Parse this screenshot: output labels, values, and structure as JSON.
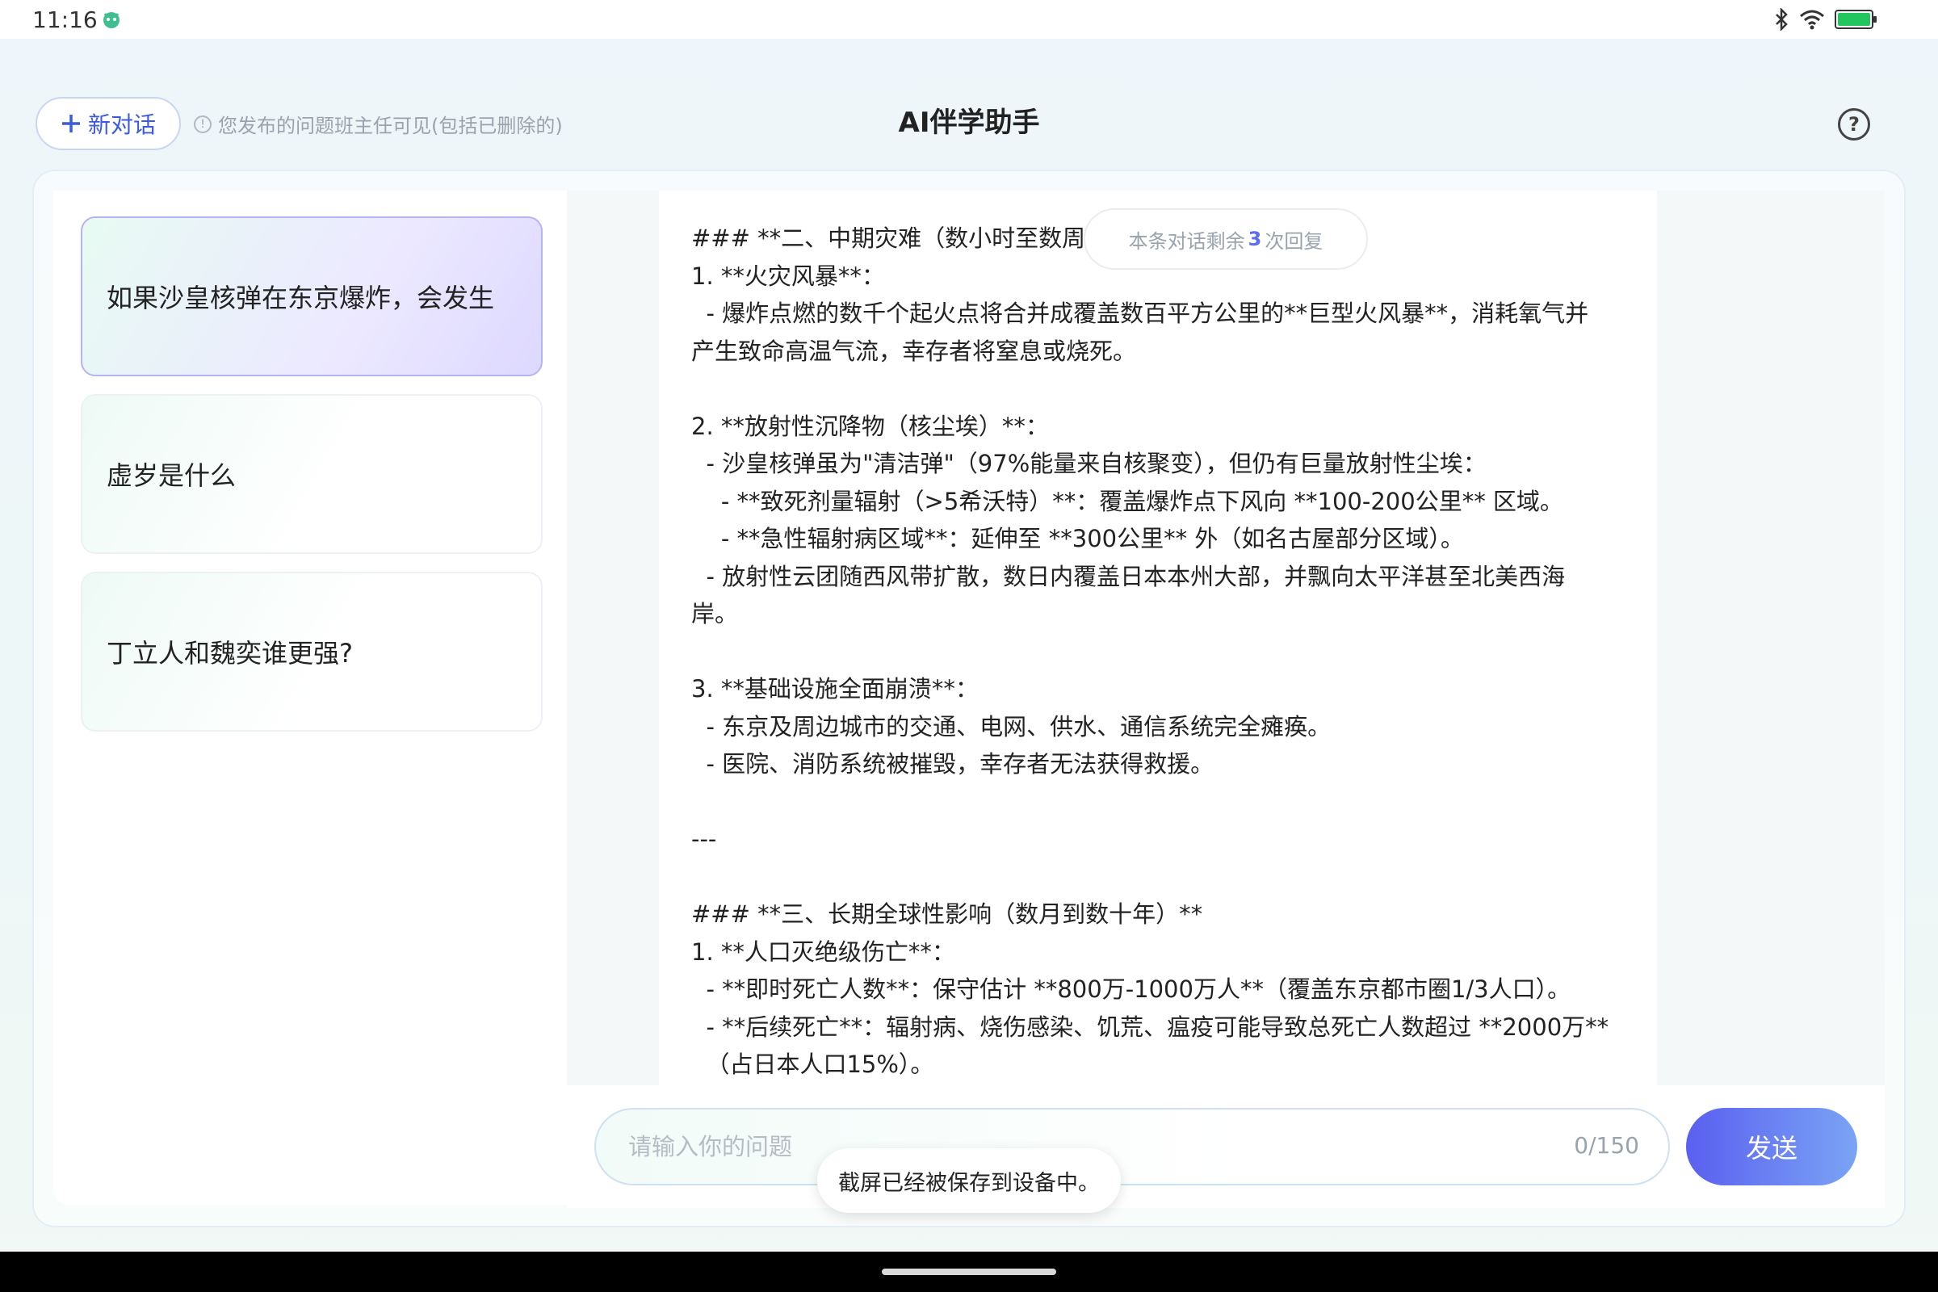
{
  "status_bar": {
    "time": "11:16",
    "battery_color": "#22c55e"
  },
  "header": {
    "new_chat_label": "新对话",
    "notice": "您发布的问题班主任可见(包括已删除的)",
    "title": "AI伴学助手"
  },
  "conversations": [
    {
      "title": "如果沙皇核弹在东京爆炸，会发生",
      "active": true
    },
    {
      "title": "虚岁是什么",
      "active": false
    },
    {
      "title": "丁立人和魏奕谁更强?",
      "active": false
    }
  ],
  "chat": {
    "remaining_prefix": "本条对话剩余",
    "remaining_count": "3",
    "remaining_suffix": "次回复",
    "lines": [
      "### **二、中期灾难（数小时至数周）",
      "1. **火灾风暴**：",
      "  - 爆炸点燃的数千个起火点将合并成覆盖数百平方公里的**巨型火风暴**，消耗氧气并",
      "产生致命高温气流，幸存者将窒息或烧死。",
      "",
      "2. **放射性沉降物（核尘埃）**：",
      "  - 沙皇核弹虽为\"清洁弹\"（97%能量来自核聚变），但仍有巨量放射性尘埃：",
      "    - **致死剂量辐射（>5希沃特）**：覆盖爆炸点下风向 **100-200公里** 区域。",
      "    - **急性辐射病区域**：延伸至 **300公里** 外（如名古屋部分区域）。",
      "  - 放射性云团随西风带扩散，数日内覆盖日本本州大部，并飘向太平洋甚至北美西海",
      "岸。",
      "",
      "3. **基础设施全面崩溃**：",
      "  - 东京及周边城市的交通、电网、供水、通信系统完全瘫痪。",
      "  - 医院、消防系统被摧毁，幸存者无法获得救援。",
      "",
      "---",
      "",
      "### **三、长期全球性影响（数月到数十年）**",
      "1. **人口灭绝级伤亡**：",
      "  - **即时死亡人数**：保守估计 **800万-1000万人**（覆盖东京都市圈1/3人口）。",
      "  - **后续死亡**：辐射病、烧伤感染、饥荒、瘟疫可能导致总死亡人数超过 **2000万**",
      "  （占日本人口15%）。"
    ]
  },
  "input": {
    "placeholder": "请输入你的问题",
    "value": "",
    "char_count": "0/150",
    "send_label": "发送"
  },
  "toast": {
    "message": "截屏已经被保存到设备中。"
  }
}
